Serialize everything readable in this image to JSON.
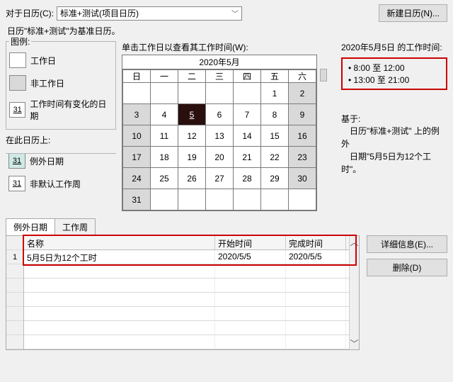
{
  "top": {
    "for_label": "对于日历(C):",
    "selected": "标准+测试(项目日历)",
    "new_btn": "新建日历(N)...",
    "baseline": "日历\"标准+测试\"为基准日历。"
  },
  "legend": {
    "title": "图例:",
    "workday": "工作日",
    "nonworkday": "非工作日",
    "edited": "工作时间有变化的日期",
    "edited_num": "31",
    "title2": "在此日历上:",
    "exception": "例外日期",
    "exception_num": "31",
    "nondefault": "非默认工作周",
    "nondefault_num": "31"
  },
  "calendar": {
    "caption": "单击工作日以查看其工作时间(W):",
    "month": "2020年5月",
    "dow": [
      "日",
      "一",
      "二",
      "三",
      "四",
      "五",
      "六"
    ],
    "rows": [
      [
        "",
        "",
        "",
        "",
        "",
        "1",
        "2"
      ],
      [
        "3",
        "4",
        "5",
        "6",
        "7",
        "8",
        "9"
      ],
      [
        "10",
        "11",
        "12",
        "13",
        "14",
        "15",
        "16"
      ],
      [
        "17",
        "18",
        "19",
        "20",
        "21",
        "22",
        "23"
      ],
      [
        "24",
        "25",
        "26",
        "27",
        "28",
        "29",
        "30"
      ],
      [
        "31",
        "",
        "",
        "",
        "",
        "",
        ""
      ]
    ],
    "gray_cols": [
      0,
      6
    ],
    "selected": "5"
  },
  "right": {
    "title": "2020年5月5日 的工作时间:",
    "hours": [
      "8:00 至 12:00",
      "13:00 至 21:00"
    ],
    "based_label": "基于:",
    "based_text1": "日历\"标准+测试\" 上的例外",
    "based_text2": "日期\"5月5日为12个工时\"。"
  },
  "tabs": {
    "exceptions": "例外日期",
    "workweeks": "工作周"
  },
  "grid": {
    "headers": {
      "name": "名称",
      "start": "开始时间",
      "end": "完成时间"
    },
    "row1": {
      "idx": "1",
      "name": "5月5日为12个工时",
      "start": "2020/5/5",
      "end": "2020/5/5"
    }
  },
  "side": {
    "details": "详细信息(E)...",
    "delete": "删除(D)"
  }
}
